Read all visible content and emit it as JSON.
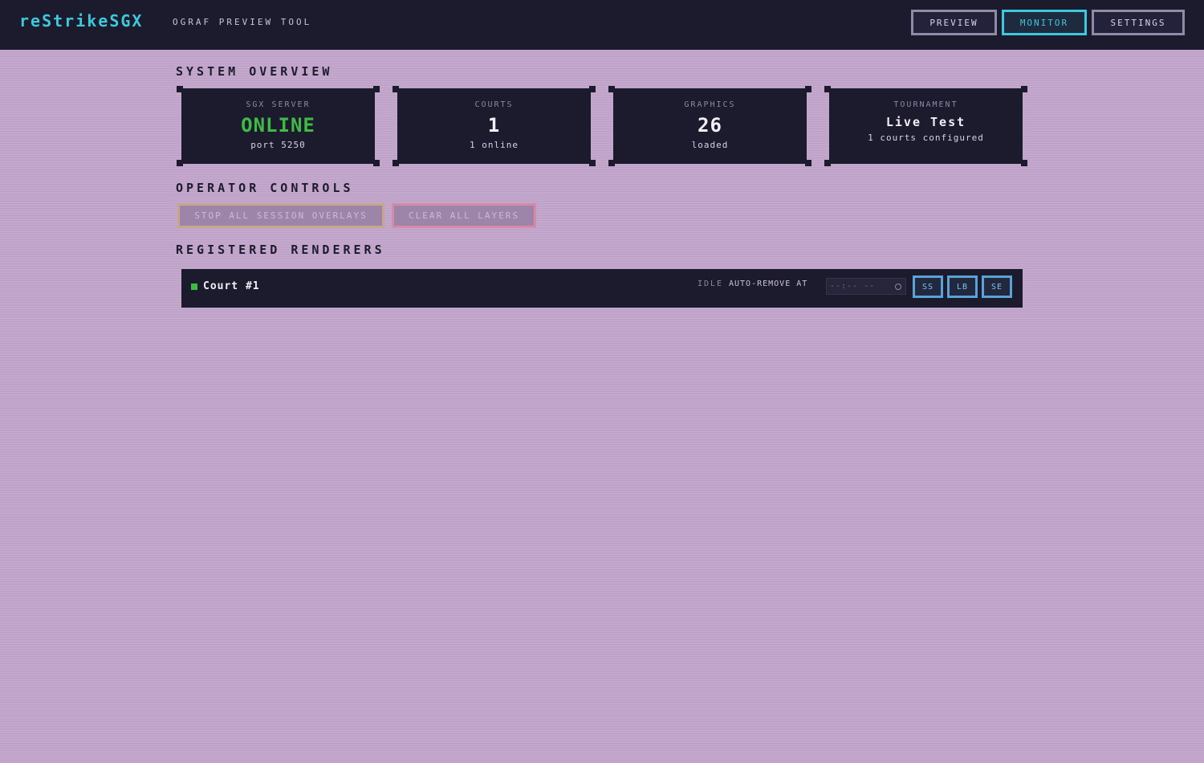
{
  "header": {
    "brand": "reStrikeSGX",
    "subtitle": "OGRAF PREVIEW TOOL",
    "nav": [
      {
        "label": "PREVIEW",
        "active": false
      },
      {
        "label": "MONITOR",
        "active": true
      },
      {
        "label": "SETTINGS",
        "active": false
      }
    ]
  },
  "overview": {
    "title": "SYSTEM OVERVIEW",
    "cards": [
      {
        "label": "SGX SERVER",
        "value": "ONLINE",
        "sub": "port 5250"
      },
      {
        "label": "COURTS",
        "value": "1",
        "sub": "1 online"
      },
      {
        "label": "GRAPHICS",
        "value": "26",
        "sub": "loaded"
      },
      {
        "label": "TOURNAMENT",
        "value": "Live Test",
        "sub": "1 courts configured"
      }
    ]
  },
  "controls": {
    "title": "OPERATOR CONTROLS",
    "stop_label": "STOP ALL SESSION OVERLAYS",
    "clear_label": "CLEAR ALL LAYERS"
  },
  "renderers": {
    "title": "REGISTERED RENDERERS",
    "items": [
      {
        "name": "Court #1",
        "state": "IDLE",
        "auto_remove_label": "AUTO-REMOVE AT",
        "time_placeholder": "--:-- --",
        "buttons": [
          "SS",
          "LB",
          "SE"
        ]
      }
    ]
  },
  "colors": {
    "accent": "#3ec8dc",
    "online": "#3fbb45",
    "background": "#c4a7cc",
    "panel": "#1c1b2e"
  }
}
